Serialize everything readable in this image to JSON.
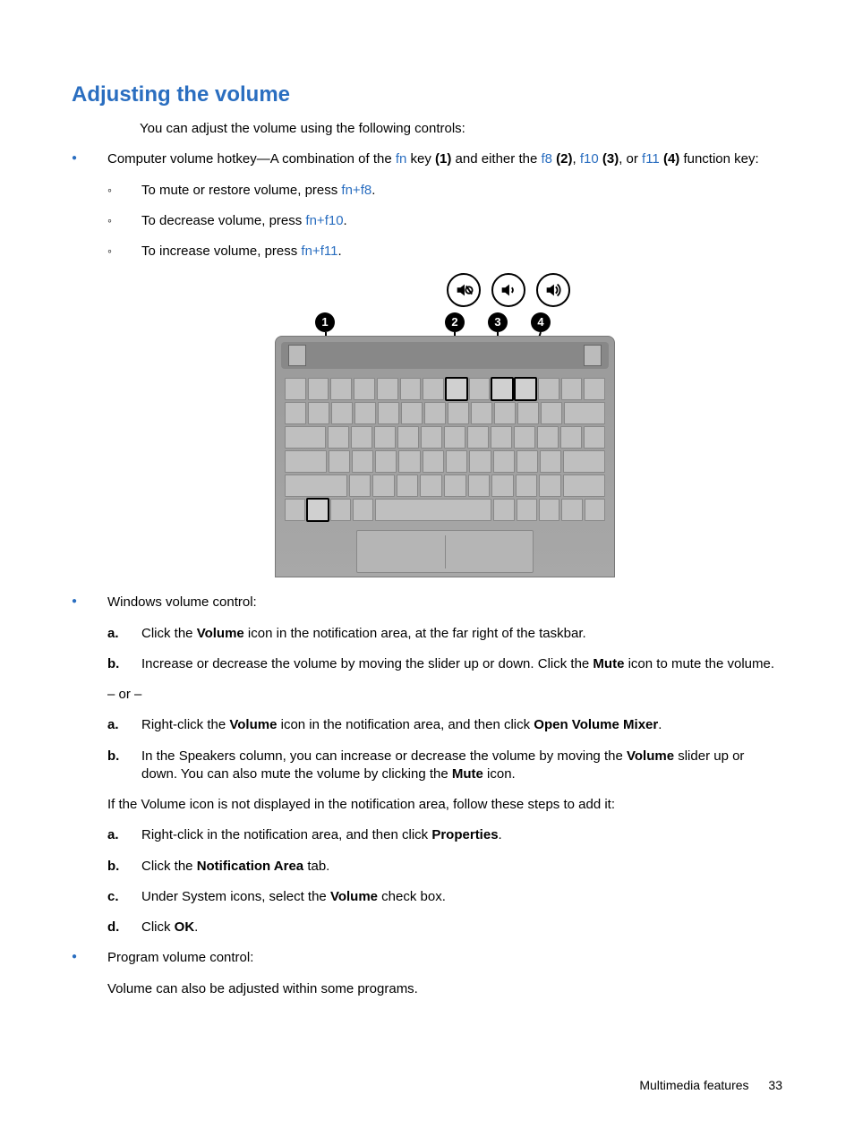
{
  "title": "Adjusting the volume",
  "intro": "You can adjust the volume using the following controls:",
  "bullet1": {
    "pre": "Computer volume hotkey—A combination of the ",
    "fn": "fn",
    "m1": " key ",
    "n1": "(1)",
    "m2": " and either the ",
    "f8": "f8",
    "n2": " (2)",
    "m3": ", ",
    "f10": "f10",
    "n3": " (3)",
    "m4": ", or ",
    "f11": "f11",
    "n4": " (4)",
    "post": " function key:"
  },
  "sub": {
    "mute": {
      "pre": "To mute or restore volume, press ",
      "k": "fn+f8",
      "post": "."
    },
    "dec": {
      "pre": "To decrease volume, press ",
      "k": "fn+f10",
      "post": "."
    },
    "inc": {
      "pre": "To increase volume, press ",
      "k": "fn+f11",
      "post": "."
    }
  },
  "bullet2_label": "Windows volume control:",
  "steps1": {
    "a": {
      "pre": "Click the ",
      "b": "Volume",
      "post": " icon in the notification area, at the far right of the taskbar."
    },
    "b": {
      "pre": "Increase or decrease the volume by moving the slider up or down. Click the ",
      "b": "Mute",
      "post": " icon to mute the volume."
    }
  },
  "or": "– or –",
  "steps2": {
    "a": {
      "pre": "Right-click the ",
      "b1": "Volume",
      "mid": " icon in the notification area, and then click ",
      "b2": "Open Volume Mixer",
      "post": "."
    },
    "b": {
      "pre": "In the Speakers column, you can increase or decrease the volume by moving the ",
      "b1": "Volume",
      "mid": " slider up or down. You can also mute the volume by clicking the ",
      "b2": "Mute",
      "post": " icon."
    }
  },
  "addnote": "If the Volume icon is not displayed in the notification area, follow these steps to add it:",
  "steps3": {
    "a": {
      "pre": "Right-click in the notification area, and then click ",
      "b": "Properties",
      "post": "."
    },
    "b": {
      "pre": "Click the ",
      "b": "Notification Area",
      "post": " tab."
    },
    "c": {
      "pre": "Under System icons, select the ",
      "b": "Volume",
      "post": " check box."
    },
    "d": {
      "pre": "Click ",
      "b": "OK",
      "post": "."
    }
  },
  "bullet3_label": "Program volume control:",
  "bullet3_text": "Volume can also be adjusted within some programs.",
  "footer_label": "Multimedia features",
  "footer_page": "33",
  "callouts": {
    "c1": "1",
    "c2": "2",
    "c3": "3",
    "c4": "4"
  }
}
